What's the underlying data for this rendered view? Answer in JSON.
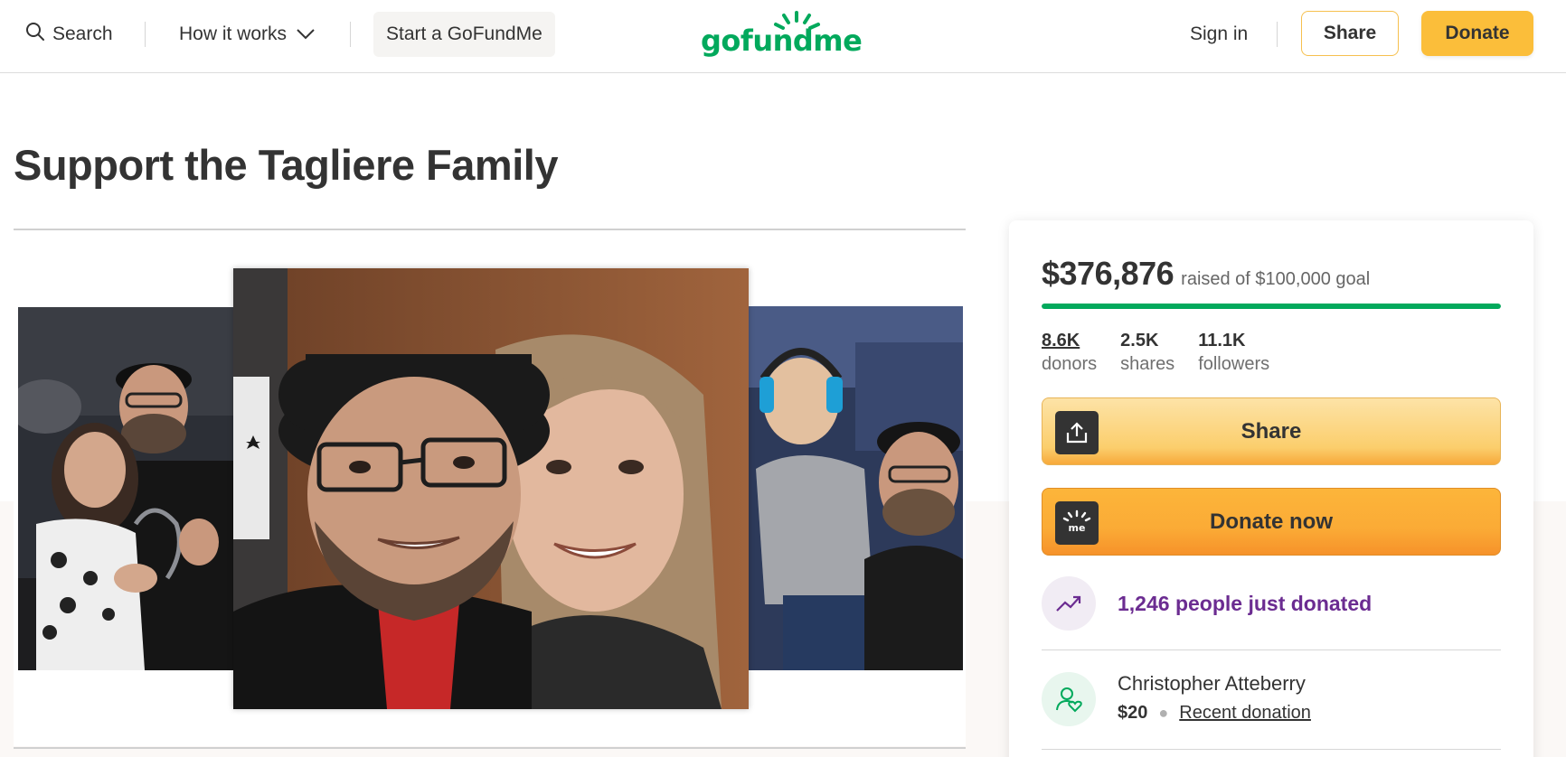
{
  "header": {
    "search_label": "Search",
    "how_label": "How it works",
    "start_label": "Start a GoFundMe",
    "logo_text": "gofundme",
    "signin_label": "Sign in",
    "share_label": "Share",
    "donate_label": "Donate"
  },
  "campaign": {
    "title": "Support the Tagliere Family"
  },
  "card": {
    "raised_amount": "$376,876",
    "raised_goal": "raised of $100,000 goal",
    "progress_percent": 100,
    "stats": [
      {
        "value": "8.6K",
        "label": "donors"
      },
      {
        "value": "2.5K",
        "label": "shares"
      },
      {
        "value": "11.1K",
        "label": "followers"
      }
    ],
    "share_button": "Share",
    "donate_button": "Donate now",
    "trend_text": "1,246 people just donated",
    "recent_donor": {
      "name": "Christopher Atteberry",
      "amount": "$20",
      "label": "Recent donation"
    }
  },
  "colors": {
    "brand_green": "#02a95c",
    "donate_yellow": "#fbbe3a",
    "trend_purple": "#6b2c91"
  },
  "icons": [
    "search-icon",
    "chevron-down-icon",
    "share-upload-icon",
    "gofundme-logo-icon",
    "trending-up-icon",
    "user-heart-icon"
  ]
}
